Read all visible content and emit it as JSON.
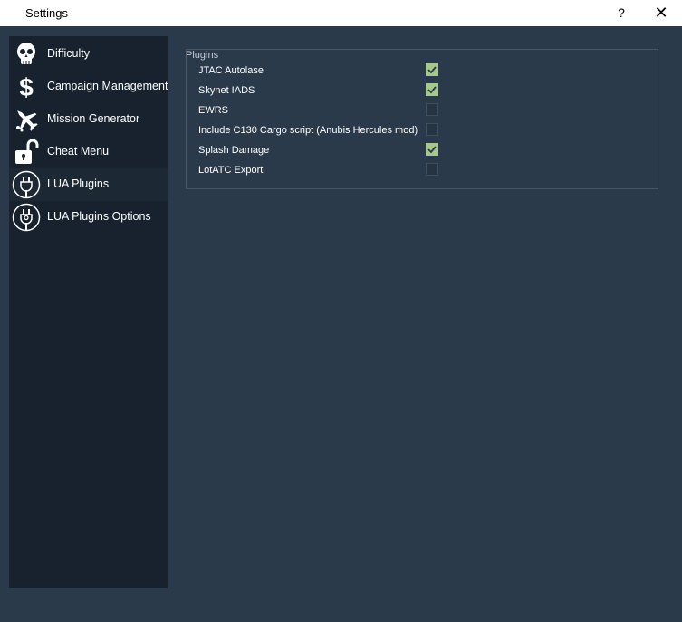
{
  "window": {
    "title": "Settings",
    "help_label": "?",
    "close_label": "✕"
  },
  "sidebar": {
    "items": [
      {
        "label": "Difficulty",
        "icon": "skull-icon"
      },
      {
        "label": "Campaign Management",
        "icon": "dollar-icon"
      },
      {
        "label": "Mission Generator",
        "icon": "jet-icon"
      },
      {
        "label": "Cheat Menu",
        "icon": "unlocked-padlock-icon"
      },
      {
        "label": "LUA Plugins",
        "icon": "plug-icon",
        "active": true
      },
      {
        "label": "LUA Plugins Options",
        "icon": "plug-options-icon"
      }
    ]
  },
  "plugins": {
    "group_title": "Plugins",
    "items": [
      {
        "label": "JTAC Autolase",
        "checked": true
      },
      {
        "label": "Skynet IADS",
        "checked": true
      },
      {
        "label": "EWRS",
        "checked": false
      },
      {
        "label": "Include C130 Cargo script (Anubis Hercules mod)",
        "checked": false
      },
      {
        "label": "Splash Damage",
        "checked": true
      },
      {
        "label": "LotATC Export",
        "checked": false
      }
    ]
  },
  "colors": {
    "checked_fill": "#a7c88d",
    "checkmark": "#2b3a4b",
    "background": "#2b3a4b",
    "sidebar": "#18222e"
  }
}
